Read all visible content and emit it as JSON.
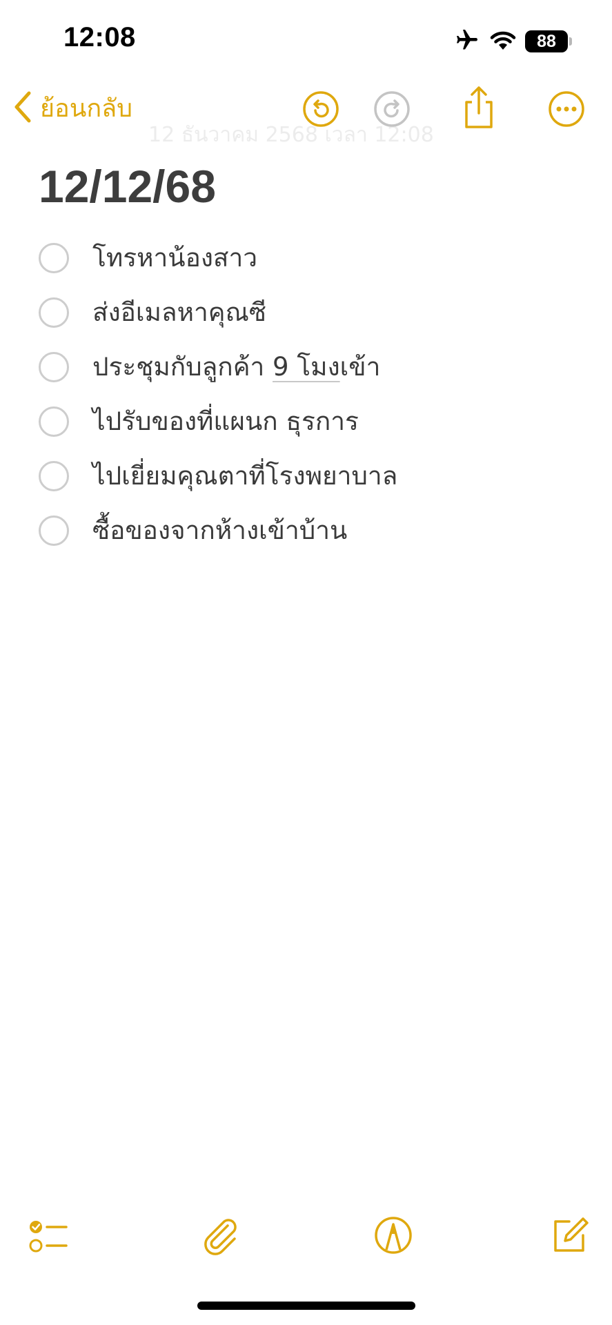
{
  "status_bar": {
    "time": "12:08",
    "battery_level": "88",
    "icons": [
      "airplane-mode-icon",
      "wifi-icon",
      "battery-icon"
    ]
  },
  "nav": {
    "back_label": "ย้อนกลับ",
    "faded_subtitle": "12 ธันวาคม 2568 เวลา 12:08",
    "icons": [
      "undo-icon",
      "redo-icon",
      "share-icon",
      "more-icon"
    ]
  },
  "note": {
    "title": "12/12/68",
    "items": [
      {
        "text": "โทรหาน้องสาว",
        "checked": false
      },
      {
        "text": "ส่งอีเมลหาคุณซี",
        "checked": false
      },
      {
        "text": "ประชุมกับลูกค้า ",
        "link_text": "9 โมง",
        "text_after": "เข้า",
        "checked": false
      },
      {
        "text": "ไปรับของที่แผนก ธุรการ",
        "checked": false
      },
      {
        "text": "ไปเยี่ยมคุณตาที่โรงพยาบาล",
        "checked": false
      },
      {
        "text": "ซื้อของจากห้างเข้าบ้าน",
        "checked": false
      }
    ]
  },
  "toolbar": {
    "icons": [
      "checklist-icon",
      "attachment-icon",
      "markup-icon",
      "compose-icon"
    ]
  },
  "colors": {
    "accent": "#dfa80e",
    "disabled": "#c4c4c4",
    "text": "#3a3a3a",
    "checkbox_border": "#cdcdcd"
  }
}
